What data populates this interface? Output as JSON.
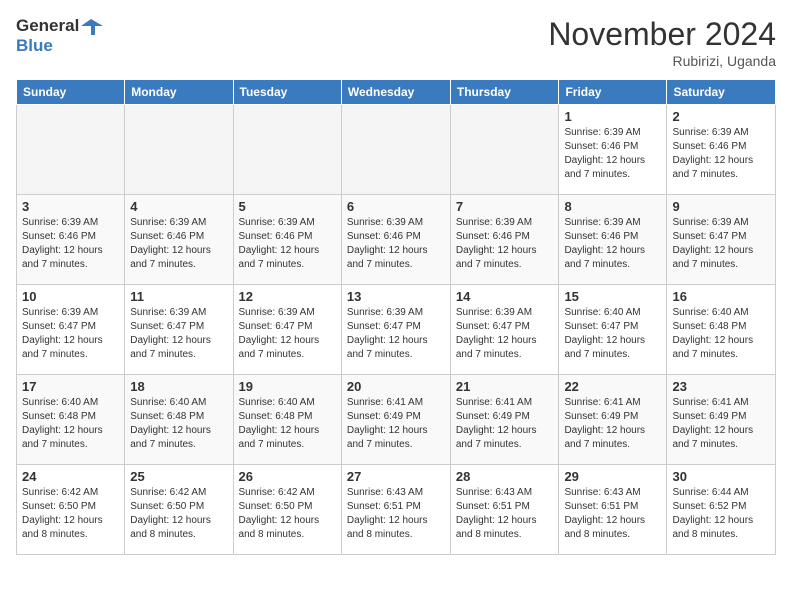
{
  "logo": {
    "line1": "General",
    "line2": "Blue"
  },
  "title": "November 2024",
  "subtitle": "Rubirizi, Uganda",
  "days_of_week": [
    "Sunday",
    "Monday",
    "Tuesday",
    "Wednesday",
    "Thursday",
    "Friday",
    "Saturday"
  ],
  "weeks": [
    [
      {
        "day": "",
        "info": ""
      },
      {
        "day": "",
        "info": ""
      },
      {
        "day": "",
        "info": ""
      },
      {
        "day": "",
        "info": ""
      },
      {
        "day": "",
        "info": ""
      },
      {
        "day": "1",
        "info": "Sunrise: 6:39 AM\nSunset: 6:46 PM\nDaylight: 12 hours\nand 7 minutes."
      },
      {
        "day": "2",
        "info": "Sunrise: 6:39 AM\nSunset: 6:46 PM\nDaylight: 12 hours\nand 7 minutes."
      }
    ],
    [
      {
        "day": "3",
        "info": "Sunrise: 6:39 AM\nSunset: 6:46 PM\nDaylight: 12 hours\nand 7 minutes."
      },
      {
        "day": "4",
        "info": "Sunrise: 6:39 AM\nSunset: 6:46 PM\nDaylight: 12 hours\nand 7 minutes."
      },
      {
        "day": "5",
        "info": "Sunrise: 6:39 AM\nSunset: 6:46 PM\nDaylight: 12 hours\nand 7 minutes."
      },
      {
        "day": "6",
        "info": "Sunrise: 6:39 AM\nSunset: 6:46 PM\nDaylight: 12 hours\nand 7 minutes."
      },
      {
        "day": "7",
        "info": "Sunrise: 6:39 AM\nSunset: 6:46 PM\nDaylight: 12 hours\nand 7 minutes."
      },
      {
        "day": "8",
        "info": "Sunrise: 6:39 AM\nSunset: 6:46 PM\nDaylight: 12 hours\nand 7 minutes."
      },
      {
        "day": "9",
        "info": "Sunrise: 6:39 AM\nSunset: 6:47 PM\nDaylight: 12 hours\nand 7 minutes."
      }
    ],
    [
      {
        "day": "10",
        "info": "Sunrise: 6:39 AM\nSunset: 6:47 PM\nDaylight: 12 hours\nand 7 minutes."
      },
      {
        "day": "11",
        "info": "Sunrise: 6:39 AM\nSunset: 6:47 PM\nDaylight: 12 hours\nand 7 minutes."
      },
      {
        "day": "12",
        "info": "Sunrise: 6:39 AM\nSunset: 6:47 PM\nDaylight: 12 hours\nand 7 minutes."
      },
      {
        "day": "13",
        "info": "Sunrise: 6:39 AM\nSunset: 6:47 PM\nDaylight: 12 hours\nand 7 minutes."
      },
      {
        "day": "14",
        "info": "Sunrise: 6:39 AM\nSunset: 6:47 PM\nDaylight: 12 hours\nand 7 minutes."
      },
      {
        "day": "15",
        "info": "Sunrise: 6:40 AM\nSunset: 6:47 PM\nDaylight: 12 hours\nand 7 minutes."
      },
      {
        "day": "16",
        "info": "Sunrise: 6:40 AM\nSunset: 6:48 PM\nDaylight: 12 hours\nand 7 minutes."
      }
    ],
    [
      {
        "day": "17",
        "info": "Sunrise: 6:40 AM\nSunset: 6:48 PM\nDaylight: 12 hours\nand 7 minutes."
      },
      {
        "day": "18",
        "info": "Sunrise: 6:40 AM\nSunset: 6:48 PM\nDaylight: 12 hours\nand 7 minutes."
      },
      {
        "day": "19",
        "info": "Sunrise: 6:40 AM\nSunset: 6:48 PM\nDaylight: 12 hours\nand 7 minutes."
      },
      {
        "day": "20",
        "info": "Sunrise: 6:41 AM\nSunset: 6:49 PM\nDaylight: 12 hours\nand 7 minutes."
      },
      {
        "day": "21",
        "info": "Sunrise: 6:41 AM\nSunset: 6:49 PM\nDaylight: 12 hours\nand 7 minutes."
      },
      {
        "day": "22",
        "info": "Sunrise: 6:41 AM\nSunset: 6:49 PM\nDaylight: 12 hours\nand 7 minutes."
      },
      {
        "day": "23",
        "info": "Sunrise: 6:41 AM\nSunset: 6:49 PM\nDaylight: 12 hours\nand 7 minutes."
      }
    ],
    [
      {
        "day": "24",
        "info": "Sunrise: 6:42 AM\nSunset: 6:50 PM\nDaylight: 12 hours\nand 8 minutes."
      },
      {
        "day": "25",
        "info": "Sunrise: 6:42 AM\nSunset: 6:50 PM\nDaylight: 12 hours\nand 8 minutes."
      },
      {
        "day": "26",
        "info": "Sunrise: 6:42 AM\nSunset: 6:50 PM\nDaylight: 12 hours\nand 8 minutes."
      },
      {
        "day": "27",
        "info": "Sunrise: 6:43 AM\nSunset: 6:51 PM\nDaylight: 12 hours\nand 8 minutes."
      },
      {
        "day": "28",
        "info": "Sunrise: 6:43 AM\nSunset: 6:51 PM\nDaylight: 12 hours\nand 8 minutes."
      },
      {
        "day": "29",
        "info": "Sunrise: 6:43 AM\nSunset: 6:51 PM\nDaylight: 12 hours\nand 8 minutes."
      },
      {
        "day": "30",
        "info": "Sunrise: 6:44 AM\nSunset: 6:52 PM\nDaylight: 12 hours\nand 8 minutes."
      }
    ]
  ]
}
